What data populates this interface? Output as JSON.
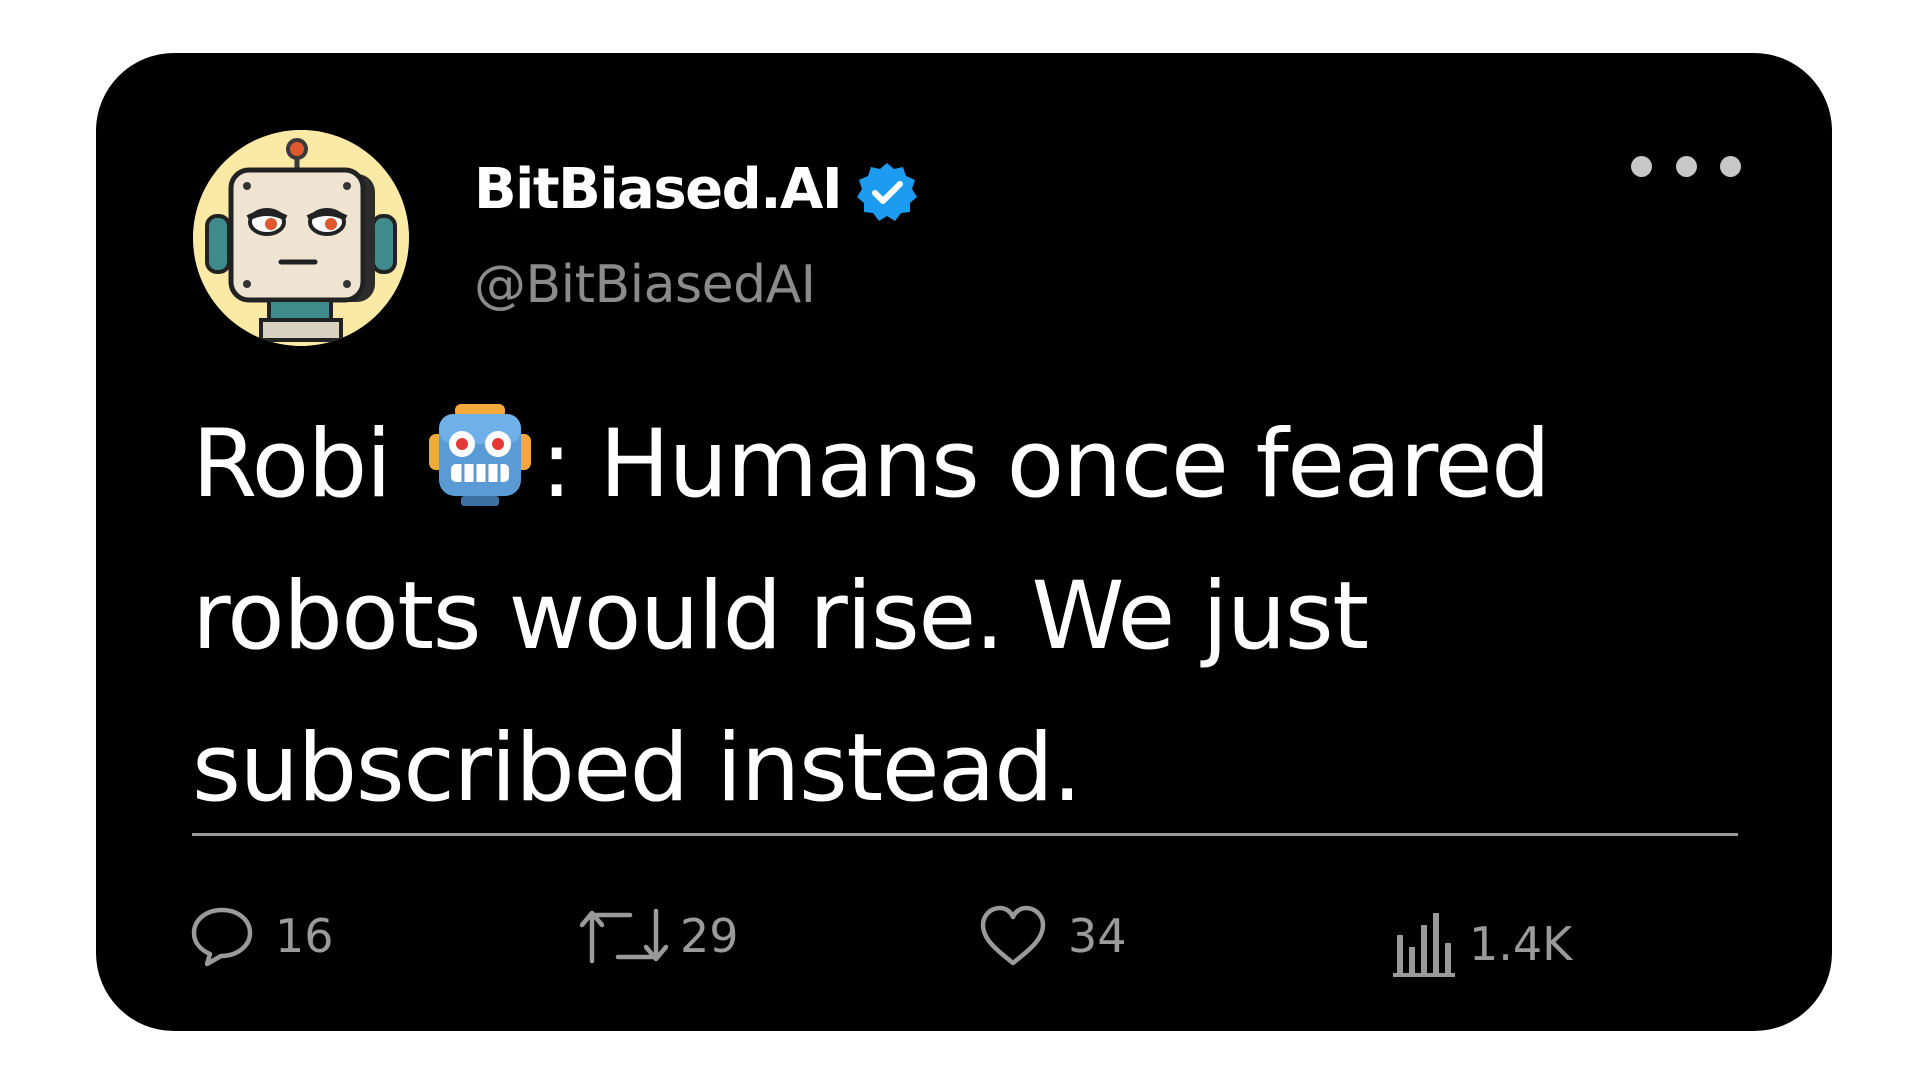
{
  "tweet": {
    "author": {
      "display_name": "BitBiased.AI",
      "handle": "@BitBiasedAI",
      "verified": true,
      "avatar_icon": "robot-face-avatar"
    },
    "text_before_emoji": "Robi ",
    "emoji": "robot-emoji",
    "text_after_emoji": ": Humans once feared robots would rise. We just subscribed instead.",
    "more_icon": "more-options-icon",
    "stats": {
      "replies": "16",
      "retweets": "29",
      "likes": "34",
      "views": "1.4K"
    }
  },
  "colors": {
    "card_background": "#000000",
    "page_background": "#ffffff",
    "text_primary": "#ffffff",
    "text_secondary": "#8b8b8b",
    "verified_badge": "#1d9bf0",
    "avatar_background": "#fbe9a6"
  }
}
